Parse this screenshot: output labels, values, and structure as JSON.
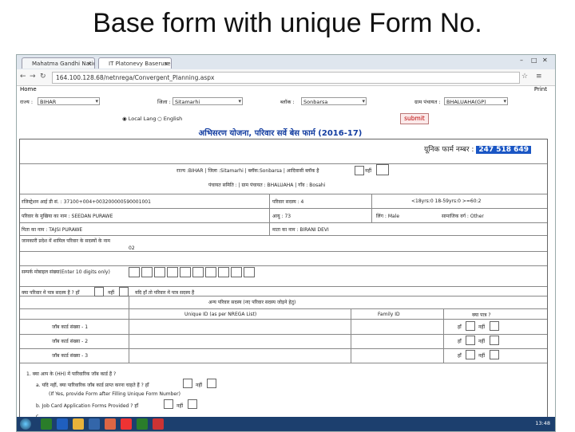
{
  "slide_title": "Base form with unique Form No.",
  "browser": {
    "tabs": [
      {
        "label": "Mahatma Gandhi Nationa",
        "close": "×"
      },
      {
        "label": "IT Platonevy Baserusen",
        "close": "×"
      }
    ],
    "url": "164.100.128.68/netnrega/Convergent_Planning.aspx"
  },
  "page": {
    "home": "Home",
    "print": "Print",
    "state_label": "राज्य :",
    "state_value": "BIHAR",
    "district_label": "जिला :",
    "district_value": "Sitamarhi",
    "block_label": "ब्लॉक :",
    "block_value": "Sonbarsa",
    "panchayat_label": "ग्राम पंचायत :",
    "panchayat_value": "BHALUAHA(GP)",
    "radio_local": "Local Lang",
    "radio_english": "English",
    "submit": "submit",
    "form_title": "अभिसरण योजना, परिवार सर्वे बेस फार्म (2016-17)",
    "unique_label": "यूनिक फार्म नम्बर :",
    "unique_number": "247 518 649"
  },
  "form": {
    "row_location": "राज्य :BIHAR | जिला :Sitamarhi | ब्लॉक:Sonbarsa | आदिवासी ब्लॉक है",
    "no_label": "नहीं",
    "row_panchayat": "पंचायत समिति : | ग्राम पंचायत : BHALUAHA | गाँव : Bosahi",
    "row_reg": "रजिस्ट्रेशन आई डी सं. : 37100+004+003200000590001001",
    "row_family": "परिवार सदस्य : 4",
    "row_age": "<18yrs:0    18-59yrs:0    >=60:2",
    "row_head": "परिवार के मुखिया का नाम : SEEDAN PURAWE",
    "row_age_head": "आयु : 73",
    "row_gender": "लिंग : Male",
    "row_caste": "सामाजिक वर्ग : Other",
    "row_father": "पिता का नाम : TAJSI PURAWE",
    "row_mother": "माता का नाम : BIRANI DEVI",
    "row_members_note": "जानकारी प्रदेश में शामिल परिवार के सदस्यों के नाम",
    "row_member_count": "02",
    "mobile_label": "सम्पर्क मोबाइल संख्या(Enter 10 digits only)",
    "row_q1": "क्या परिवार में पात्र सदस्य हैं ? हाँ",
    "row_q1b": "नहीं",
    "row_q2": "यदि हाँ तो परिवार में पात्र सदस्य हैं",
    "table_caption": "अन्य परिवार सदस्य (नए परिवार सदस्य जोड़ने हेतु)",
    "col_unique": "Unique ID (as per NREGA List)",
    "col_family": "Family ID",
    "col_status": "क्या पात्र ?",
    "table_rows": [
      {
        "label": "जॉब कार्ड संख्या - 1"
      },
      {
        "label": "जॉब कार्ड संख्या - 2"
      },
      {
        "label": "जॉब कार्ड संख्या - 3"
      }
    ],
    "yes_label": "हाँ",
    "q_section_1": "1.  क्या आप के (HH) में पारिवारिक जॉब कार्ड हैं ?",
    "q_a": "a.  यदि नहीं, क्या पारिवारिक जॉब कार्ड प्राप्त करना चाहते हैं ? हाँ",
    "q_a_note": "(If Yes, provide Form after Filling Unique Form Number)",
    "q_b": "b.  Job Card Application Forms Provided ? हाँ",
    "q_c": "c."
  },
  "taskbar": {
    "clock": "13:48"
  }
}
